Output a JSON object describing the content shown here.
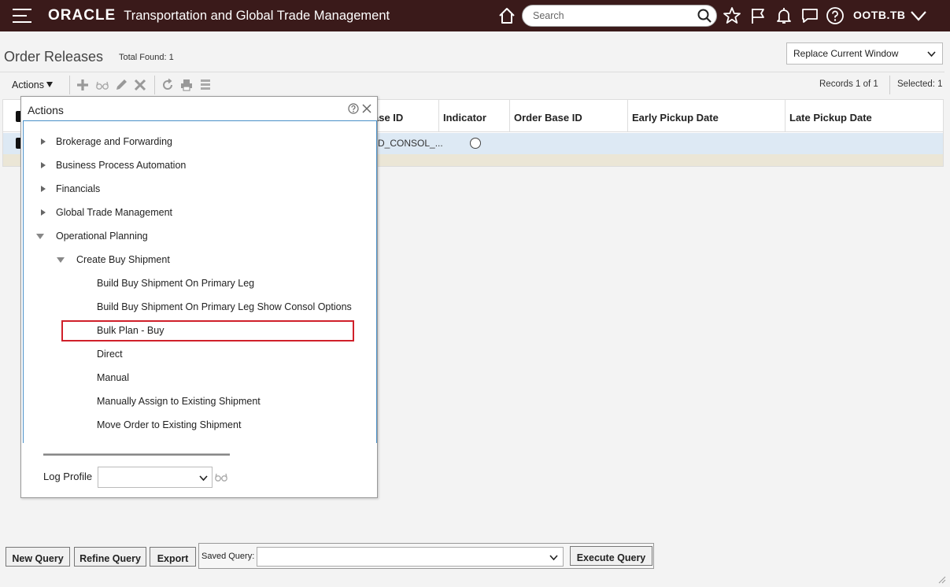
{
  "header": {
    "logo": "ORACLE",
    "app_title": "Transportation and Global Trade Management",
    "search_placeholder": "Search",
    "user": "OOTB.TB",
    "bg_color": "#3a1a1a"
  },
  "page": {
    "title": "Order Releases",
    "total_found": "Total Found: 1",
    "window_mode": "Replace Current Window",
    "records": "Records  1  of  1",
    "selected_label": "Selected:",
    "selected_count": "1"
  },
  "toolbar": {
    "actions_label": "Actions",
    "icons": [
      "plus-icon",
      "glasses-icon",
      "pencil-icon",
      "delete-x-icon",
      "refresh-icon",
      "print-icon",
      "stack-icon"
    ]
  },
  "grid": {
    "columns": [
      "ase ID",
      "Indicator",
      "Order Base ID",
      "Early Pickup Date",
      "Late Pickup Date"
    ],
    "row": {
      "base_id": "D_CONSOL_..."
    }
  },
  "actions_popup": {
    "title": "Actions",
    "items": [
      {
        "label": "Brokerage and Forwarding",
        "state": "collapsed"
      },
      {
        "label": "Business Process Automation",
        "state": "collapsed"
      },
      {
        "label": "Financials",
        "state": "collapsed"
      },
      {
        "label": "Global Trade Management",
        "state": "collapsed"
      },
      {
        "label": "Operational Planning",
        "state": "expanded"
      },
      {
        "label": "Create Buy Shipment",
        "state": "expanded"
      },
      {
        "label": "Build Buy Shipment On Primary Leg",
        "state": "leaf"
      },
      {
        "label": "Build Buy Shipment On Primary Leg Show Consol Options",
        "state": "leaf"
      },
      {
        "label": "Bulk Plan - Buy",
        "state": "leaf-highlighted"
      },
      {
        "label": "Direct",
        "state": "leaf"
      },
      {
        "label": "Manual",
        "state": "leaf"
      },
      {
        "label": "Manually Assign to Existing Shipment",
        "state": "leaf"
      },
      {
        "label": "Move Order to Existing Shipment",
        "state": "leaf"
      }
    ],
    "log_profile_label": "Log Profile",
    "log_profile_value": "",
    "highlight_color": "#d0202a"
  },
  "query_bar": {
    "new_query": "New Query",
    "refine_query": "Refine Query",
    "export": "Export",
    "saved_query_label": "Saved Query:",
    "saved_query_value": "",
    "execute_query": "Execute Query"
  }
}
